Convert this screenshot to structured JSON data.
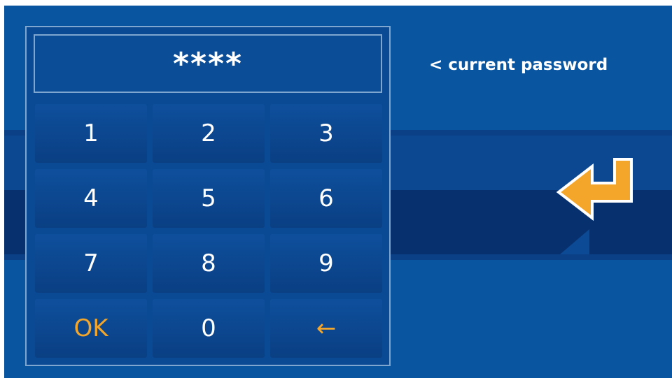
{
  "display": {
    "masked_value": "****"
  },
  "hint": {
    "text": "< current password"
  },
  "keypad": {
    "keys": [
      {
        "label": "1"
      },
      {
        "label": "2"
      },
      {
        "label": "3"
      },
      {
        "label": "4"
      },
      {
        "label": "5"
      },
      {
        "label": "6"
      },
      {
        "label": "7"
      },
      {
        "label": "8"
      },
      {
        "label": "9"
      },
      {
        "label": "OK"
      },
      {
        "label": "0"
      },
      {
        "label": "←"
      }
    ]
  },
  "icons": {
    "enter": "enter-return-arrow-icon"
  },
  "colors": {
    "background": "#0a55a0",
    "panel": "#0a4a95",
    "accent": "#f4a62a",
    "text": "#ffffff"
  }
}
